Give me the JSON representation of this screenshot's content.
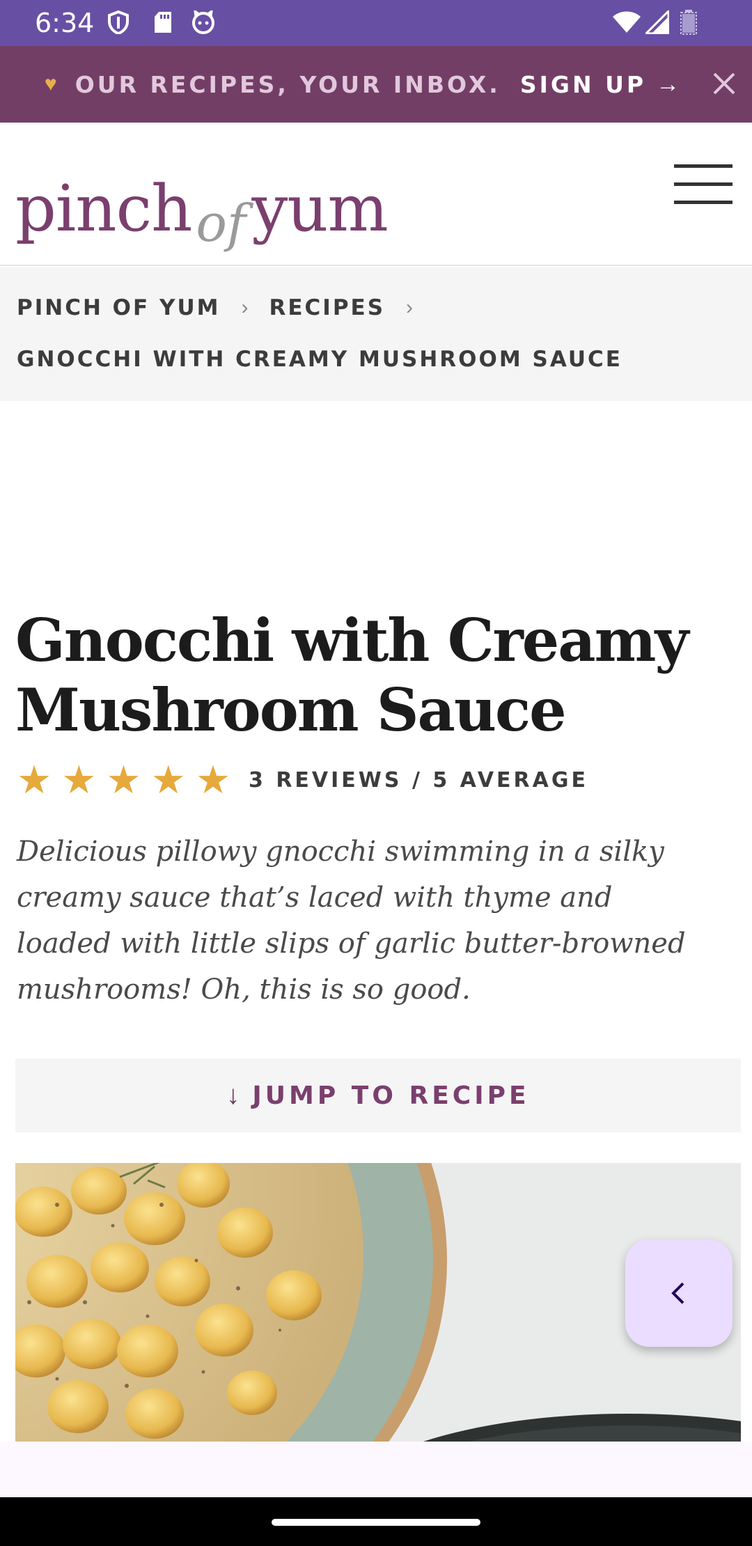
{
  "status_bar": {
    "time": "6:34",
    "icons": [
      "shield-icon",
      "sd-card-icon",
      "cat-icon",
      "wifi-icon",
      "signal-icon",
      "battery-icon"
    ]
  },
  "promo": {
    "text": "OUR RECIPES, YOUR INBOX.",
    "cta": "SIGN UP",
    "arrow": "→",
    "heart": "♥",
    "bg_color": "#733e66"
  },
  "header": {
    "logo_left": "pinch",
    "logo_of": "of",
    "logo_right": "yum",
    "brand_color": "#7a3f6e"
  },
  "breadcrumb": {
    "items": [
      "PINCH OF YUM",
      "RECIPES"
    ],
    "separator": "›",
    "current": "GNOCCHI WITH CREAMY MUSHROOM SAUCE"
  },
  "article": {
    "title_line1": "Gnocchi with Creamy",
    "title_line2": "Mushroom Sauce",
    "rating": {
      "stars": 5,
      "star_glyph": "★",
      "text": "3 REVIEWS / 5 AVERAGE",
      "star_color": "#e6a93c"
    },
    "description": "Delicious pillowy gnocchi swimming in a silky creamy sauce that’s laced with thyme and loaded with little slips of garlic butter-browned mushrooms! Oh, this is so good.",
    "jump_label": "JUMP TO RECIPE",
    "jump_arrow": "↓"
  },
  "fab": {
    "icon": "chevron-left-icon",
    "color": "#eaddff"
  }
}
